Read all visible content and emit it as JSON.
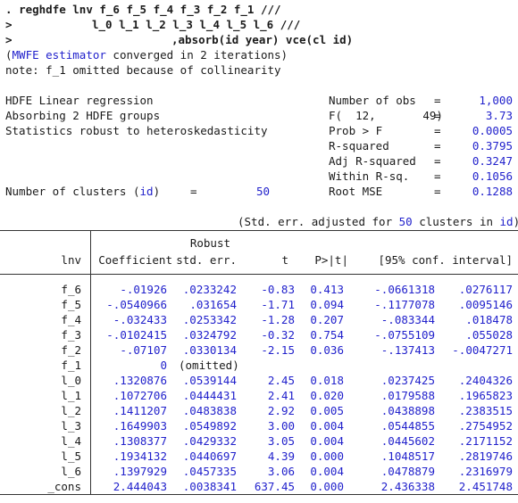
{
  "command": {
    "prompt": ".",
    "cont": ">",
    "line1": "reghdfe lnv f_6 f_5 f_4 f_3 f_2 f_1 ///",
    "line2": "l_0 l_1 l_2 l_3 l_4 l_5 l_6 ///",
    "line3": ",absorb(id year) vce(cl id)"
  },
  "messages": {
    "paren_open": "(",
    "estimator": "MWFE estimator",
    "converged": " converged in 2 iterations)",
    "note": "note: f_1 omitted because of collinearity"
  },
  "header_left": {
    "l1": "HDFE Linear regression",
    "l2": "Absorbing 2 HDFE groups",
    "l3": "Statistics robust to heteroskedasticity",
    "clusters_label": "Number of clusters (",
    "clusters_var": "id",
    "clusters_close": ")",
    "clusters_eq": "=",
    "clusters_value": "50"
  },
  "header_right": [
    {
      "label": "Number of obs",
      "eq": "=",
      "value": "1,000"
    },
    {
      "label": "F(  12,       49)",
      "eq": "=",
      "value": "3.73"
    },
    {
      "label": "Prob > F",
      "eq": "=",
      "value": "0.0005"
    },
    {
      "label": "R-squared",
      "eq": "=",
      "value": "0.3795"
    },
    {
      "label": "Adj R-squared",
      "eq": "=",
      "value": "0.3247"
    },
    {
      "label": "Within R-sq.",
      "eq": "=",
      "value": "0.1056"
    },
    {
      "label": "Root MSE",
      "eq": "=",
      "value": "0.1288"
    }
  ],
  "adjust_note": {
    "pre": "(Std. err. adjusted for ",
    "num": "50",
    "mid": " clusters in ",
    "var": "id",
    "post": ")"
  },
  "table": {
    "depvar": "lnv",
    "col_coef": "Coefficient",
    "col_se_top": "Robust",
    "col_se": "std. err.",
    "col_t": "t",
    "col_p": "P>|t|",
    "col_ci": "[95% conf. interval]",
    "rows": [
      {
        "name": "f_6",
        "coef": "-.01926",
        "se": ".0233242",
        "t": "-0.83",
        "p": "0.413",
        "lo": "-.0661318",
        "hi": ".0276117"
      },
      {
        "name": "f_5",
        "coef": "-.0540966",
        "se": ".031654",
        "t": "-1.71",
        "p": "0.094",
        "lo": "-.1177078",
        "hi": ".0095146"
      },
      {
        "name": "f_4",
        "coef": "-.032433",
        "se": ".0253342",
        "t": "-1.28",
        "p": "0.207",
        "lo": "-.083344",
        "hi": ".018478"
      },
      {
        "name": "f_3",
        "coef": "-.0102415",
        "se": ".0324792",
        "t": "-0.32",
        "p": "0.754",
        "lo": "-.0755109",
        "hi": ".055028"
      },
      {
        "name": "f_2",
        "coef": "-.07107",
        "se": ".0330134",
        "t": "-2.15",
        "p": "0.036",
        "lo": "-.137413",
        "hi": "-.0047271"
      },
      {
        "name": "f_1",
        "coef": "0",
        "se": "(omitted)",
        "t": "",
        "p": "",
        "lo": "",
        "hi": ""
      },
      {
        "name": "l_0",
        "coef": ".1320876",
        "se": ".0539144",
        "t": "2.45",
        "p": "0.018",
        "lo": ".0237425",
        "hi": ".2404326"
      },
      {
        "name": "l_1",
        "coef": ".1072706",
        "se": ".0444431",
        "t": "2.41",
        "p": "0.020",
        "lo": ".0179588",
        "hi": ".1965823"
      },
      {
        "name": "l_2",
        "coef": ".1411207",
        "se": ".0483838",
        "t": "2.92",
        "p": "0.005",
        "lo": ".0438898",
        "hi": ".2383515"
      },
      {
        "name": "l_3",
        "coef": ".1649903",
        "se": ".0549892",
        "t": "3.00",
        "p": "0.004",
        "lo": ".0544855",
        "hi": ".2754952"
      },
      {
        "name": "l_4",
        "coef": ".1308377",
        "se": ".0429332",
        "t": "3.05",
        "p": "0.004",
        "lo": ".0445602",
        "hi": ".2171152"
      },
      {
        "name": "l_5",
        "coef": ".1934132",
        "se": ".0440697",
        "t": "4.39",
        "p": "0.000",
        "lo": ".1048517",
        "hi": ".2819746"
      },
      {
        "name": "l_6",
        "coef": ".1397929",
        "se": ".0457335",
        "t": "3.06",
        "p": "0.004",
        "lo": ".0478879",
        "hi": ".2316979"
      },
      {
        "name": "_cons",
        "coef": "2.444043",
        "se": ".0038341",
        "t": "637.45",
        "p": "0.000",
        "lo": "2.436338",
        "hi": "2.451748"
      }
    ]
  },
  "colors": {
    "text": "#1a1a1a",
    "accent_blue": "#2222cc",
    "background": "#ffffff"
  }
}
